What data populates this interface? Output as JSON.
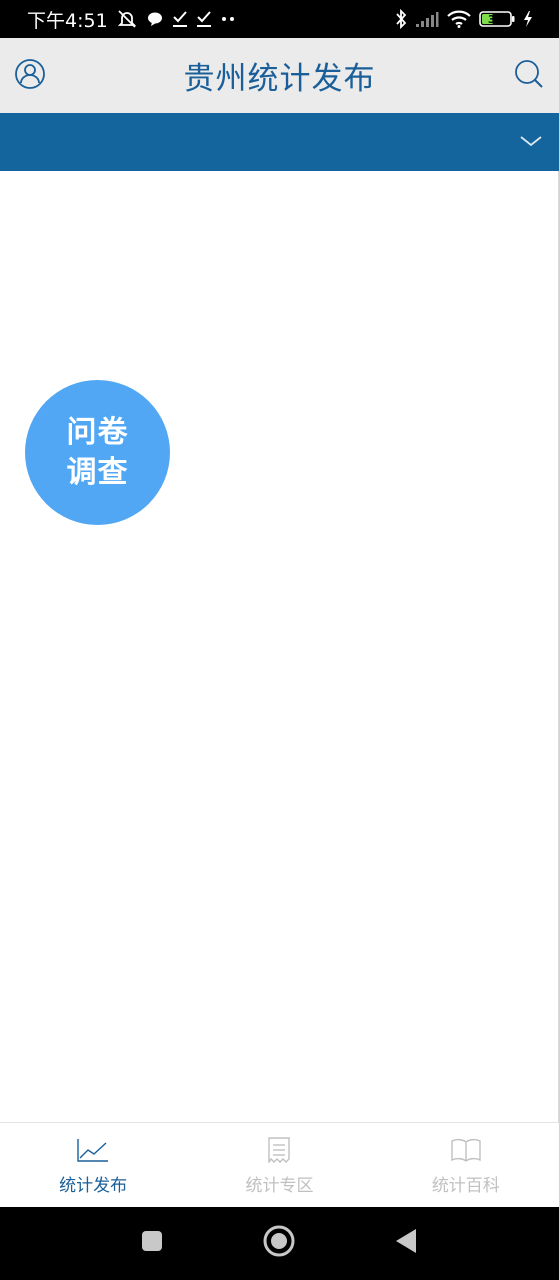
{
  "status_bar": {
    "time": "下午4:51",
    "battery": "36",
    "icons": [
      "mute-icon",
      "chat-bubble-icon",
      "check-download-icon",
      "check-download-icon",
      "more-dots-icon",
      "bluetooth-icon",
      "signal-icon",
      "wifi-icon",
      "battery-icon",
      "charging-icon"
    ]
  },
  "header": {
    "title": "贵州统计发布",
    "left_icon": "user-profile-icon",
    "right_icon": "search-icon"
  },
  "category_bar": {
    "dropdown_icon": "chevron-down-icon"
  },
  "survey_button": {
    "line1": "问卷",
    "line2": "调查"
  },
  "tabs": [
    {
      "label": "统计发布",
      "icon": "line-chart-icon",
      "active": true
    },
    {
      "label": "统计专区",
      "icon": "document-icon",
      "active": false
    },
    {
      "label": "统计百科",
      "icon": "open-book-icon",
      "active": false
    }
  ],
  "colors": {
    "primary": "#1a5f99",
    "category_bar": "#14659d",
    "survey_button": "#51a7f3",
    "inactive_tab": "#c0c0c0"
  }
}
